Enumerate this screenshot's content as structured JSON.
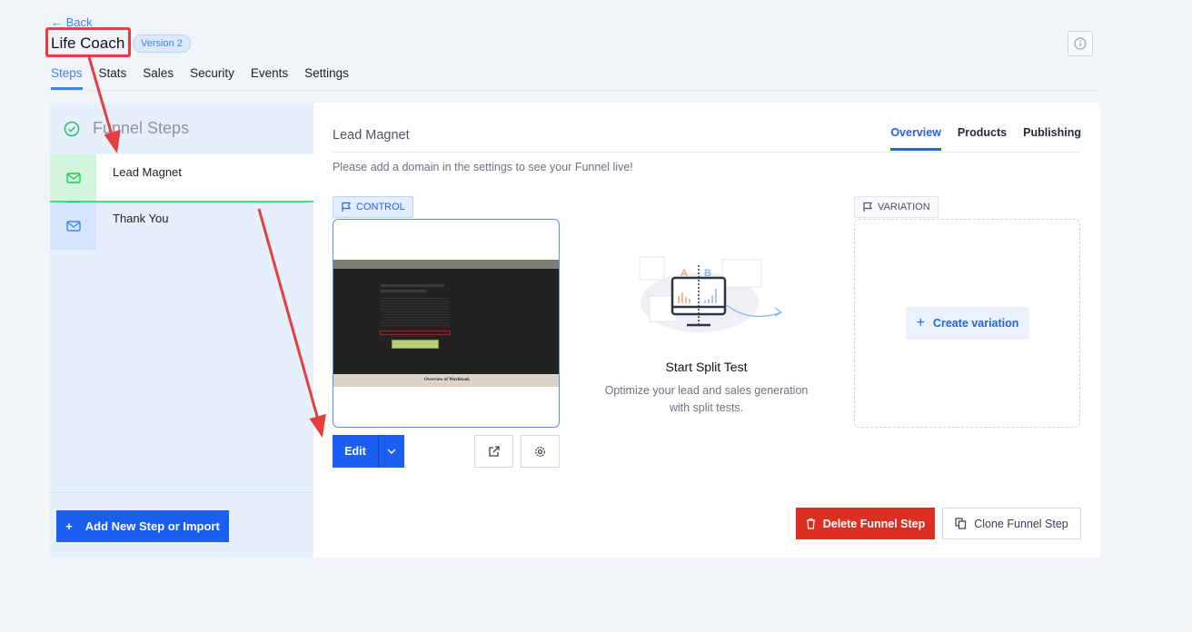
{
  "header": {
    "back_label": "← Back",
    "title": "Life Coach",
    "version_badge": "Version 2"
  },
  "nav_tabs": [
    {
      "label": "Steps",
      "active": true
    },
    {
      "label": "Stats"
    },
    {
      "label": "Sales"
    },
    {
      "label": "Security"
    },
    {
      "label": "Events"
    },
    {
      "label": "Settings"
    }
  ],
  "sidebar": {
    "heading": "Funnel Steps",
    "steps": [
      {
        "label": "Lead Magnet",
        "icon": "mail-icon",
        "active": true
      },
      {
        "label": "Thank You",
        "icon": "mail-icon"
      }
    ],
    "add_button": "Add New Step or Import"
  },
  "main": {
    "step_title": "Lead Magnet",
    "tabs": [
      {
        "label": "Overview",
        "active": true
      },
      {
        "label": "Products"
      },
      {
        "label": "Publishing"
      }
    ],
    "notice": "Please add a domain in the settings to see your Funnel live!",
    "control_tag": "CONTROL",
    "variation_tag": "VARIATION",
    "preview_footer_text": "Overview of Workbook",
    "edit_button": "Edit",
    "split_test": {
      "title": "Start Split Test",
      "description": "Optimize your lead and sales generation with split tests.",
      "label_a": "A",
      "label_b": "B"
    },
    "create_variation": "Create variation",
    "delete_button": "Delete Funnel Step",
    "clone_button": "Clone Funnel Step"
  },
  "colors": {
    "primary": "#1a5ff0",
    "danger": "#dc2f23",
    "success": "#22c55e",
    "annotation": "#e53e3e"
  }
}
